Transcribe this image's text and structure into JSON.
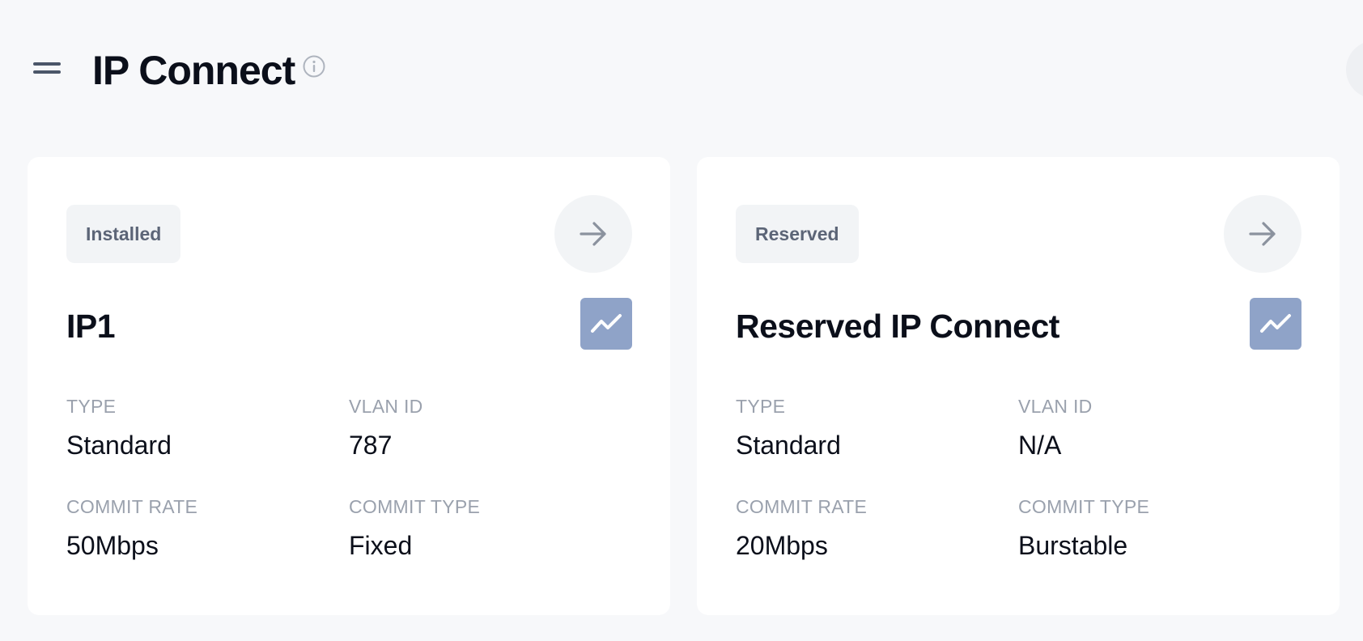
{
  "page": {
    "title": "IP Connect"
  },
  "colors": {
    "background": "#f7f8fa",
    "card": "#ffffff",
    "badge_background": "#f2f4f6",
    "graph_button": "#8fa3c8",
    "label": "#9aa1ad",
    "text": "#0b0f1a"
  },
  "icons": {
    "menu": "hamburger-menu-icon",
    "info": "info-icon",
    "go": "arrow-right-icon",
    "graph": "trend-line-icon"
  },
  "cards": [
    {
      "status": "Installed",
      "name": "IP1",
      "fields": [
        {
          "label": "TYPE",
          "value": "Standard"
        },
        {
          "label": "VLAN ID",
          "value": "787"
        },
        {
          "label": "COMMIT RATE",
          "value": "50Mbps"
        },
        {
          "label": "COMMIT TYPE",
          "value": "Fixed"
        }
      ]
    },
    {
      "status": "Reserved",
      "name": "Reserved IP Connect",
      "fields": [
        {
          "label": "TYPE",
          "value": "Standard"
        },
        {
          "label": "VLAN ID",
          "value": "N/A"
        },
        {
          "label": "COMMIT RATE",
          "value": "20Mbps"
        },
        {
          "label": "COMMIT TYPE",
          "value": "Burstable"
        }
      ]
    }
  ]
}
